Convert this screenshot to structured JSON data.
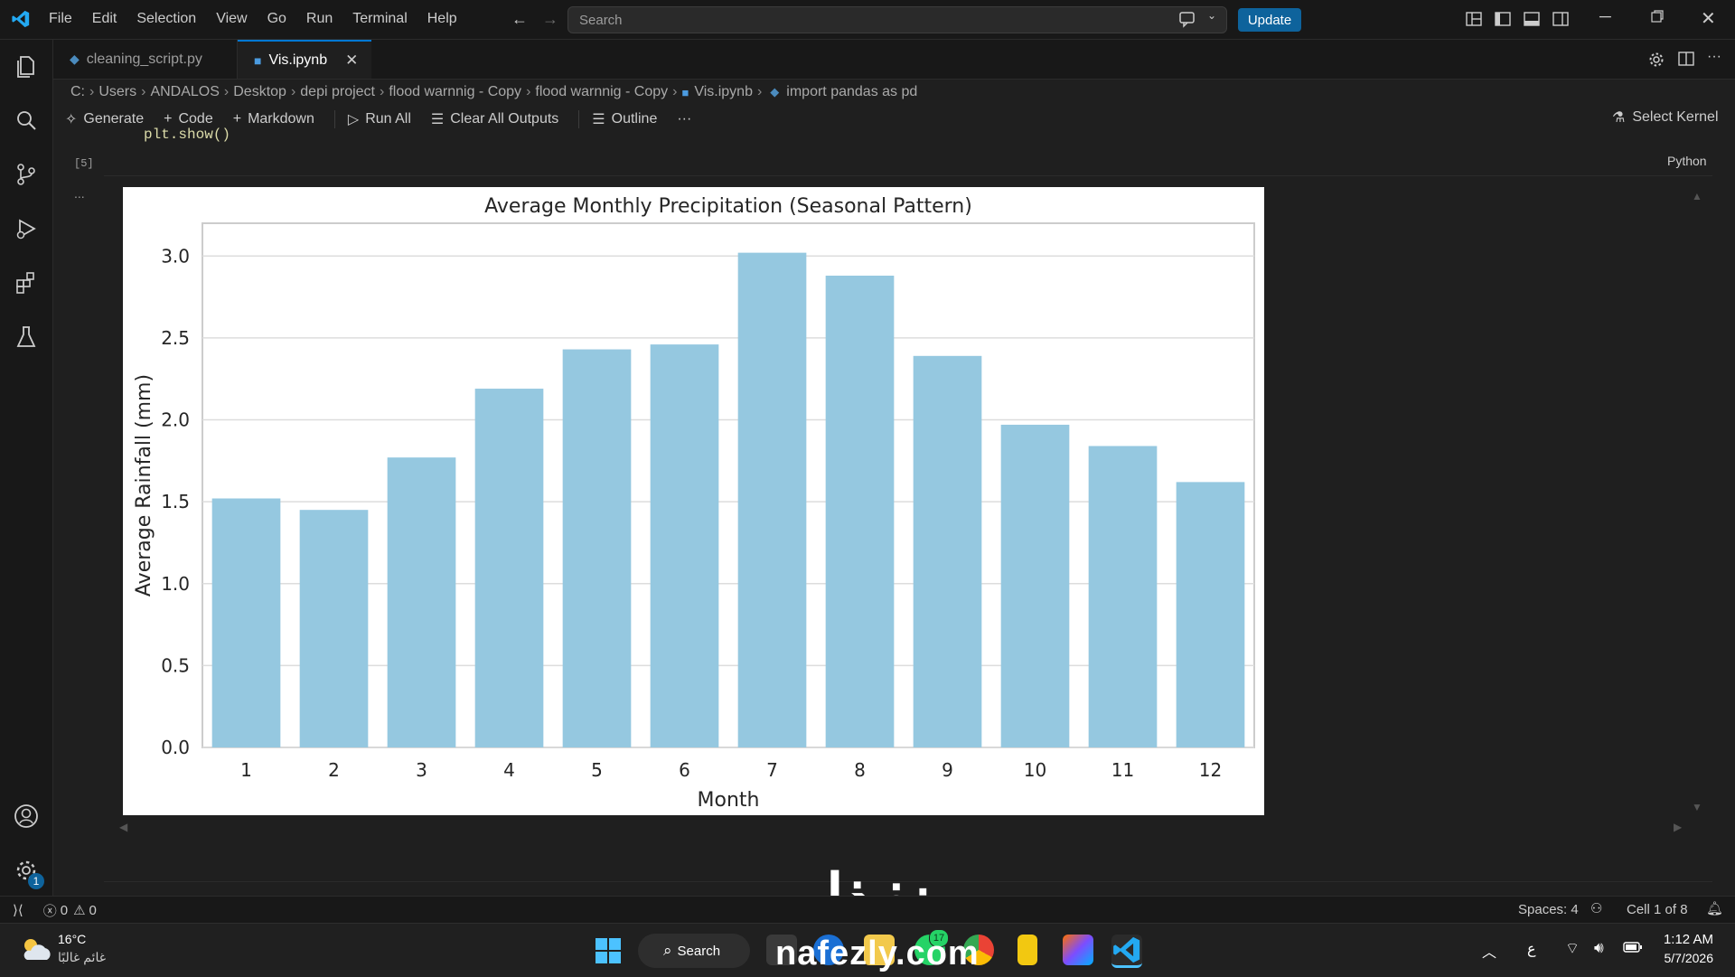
{
  "menu": [
    "File",
    "Edit",
    "Selection",
    "View",
    "Go",
    "Run",
    "Terminal",
    "Help"
  ],
  "search": {
    "placeholder": "Search"
  },
  "update_label": "Update",
  "tabs": [
    {
      "label": "cleaning_script.py",
      "active": false
    },
    {
      "label": "Vis.ipynb",
      "active": true
    }
  ],
  "breadcrumb": [
    "C:",
    "Users",
    "ANDALOS",
    "Desktop",
    "depi project",
    "flood warnnig - Copy",
    "flood warnnig - Copy",
    "Vis.ipynb",
    "import pandas as pd"
  ],
  "toolbar": {
    "generate": "Generate",
    "code": "Code",
    "markdown": "Markdown",
    "run_all": "Run All",
    "clear_outputs": "Clear All Outputs",
    "outline": "Outline",
    "more": "···",
    "select_kernel": "Select Kernel"
  },
  "cell": {
    "code_line": "plt.show()",
    "exec_count": "[5]",
    "language": "Python",
    "output_more": "..."
  },
  "chart_data": {
    "type": "bar",
    "title": "Average Monthly Precipitation (Seasonal Pattern)",
    "xlabel": "Month",
    "ylabel": "Average Rainfall (mm)",
    "categories": [
      "1",
      "2",
      "3",
      "4",
      "5",
      "6",
      "7",
      "8",
      "9",
      "10",
      "11",
      "12"
    ],
    "values": [
      1.52,
      1.45,
      1.77,
      2.19,
      2.43,
      2.46,
      3.02,
      2.88,
      2.39,
      1.97,
      1.84,
      1.62
    ],
    "ylim": [
      0,
      3.2
    ],
    "yticks": [
      "0.0",
      "0.5",
      "1.0",
      "1.5",
      "2.0",
      "2.5",
      "3.0"
    ],
    "grid": true,
    "bar_color": "#95c8e0"
  },
  "status": {
    "errors": "0",
    "warnings": "0",
    "spaces": "Spaces: 4",
    "cell": "Cell 1 of 8"
  },
  "taskbar": {
    "temp": "16°C",
    "weather_desc": "غائم غالبًا",
    "search_label": "Search",
    "whatsapp_badge": "17",
    "lang": "ع",
    "time": "1:12 AM",
    "date": "5/7/2026"
  },
  "watermark": {
    "arabic": "نفذلي",
    "latin": "nafezly.com"
  },
  "colors": {
    "accent": "#0e639c",
    "bar": "#95c8e0",
    "badge": "#0e639c"
  }
}
